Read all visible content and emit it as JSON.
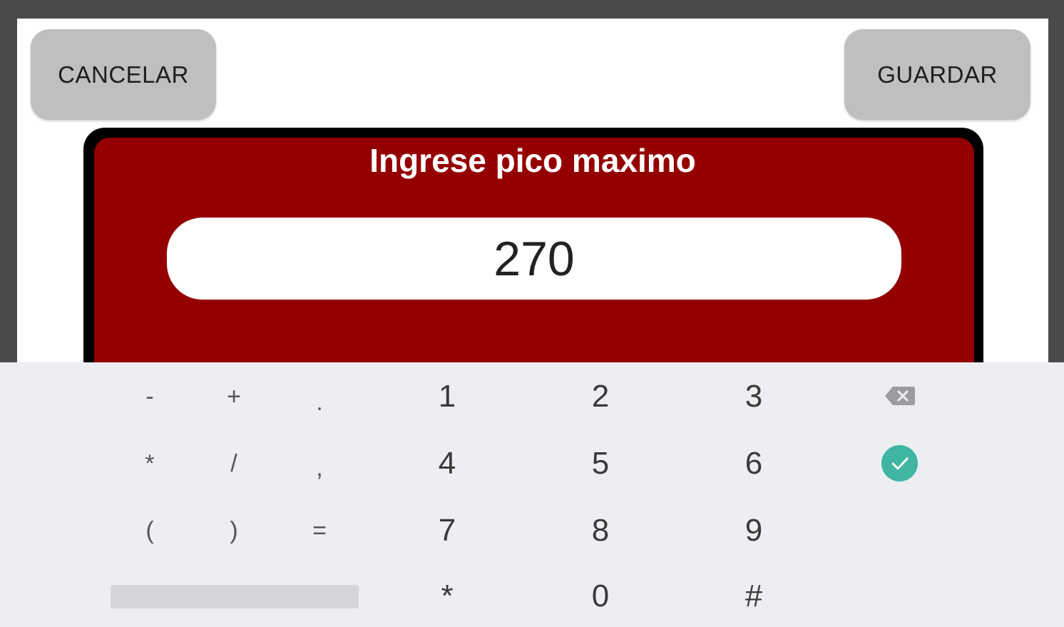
{
  "toolbar": {
    "cancel_label": "CANCELAR",
    "save_label": "GUARDAR"
  },
  "dialog": {
    "title": "Ingrese pico maximo",
    "value": "270"
  },
  "keyboard": {
    "row1": [
      "-",
      "+",
      ".",
      "1",
      "2",
      "3"
    ],
    "row2": [
      "*",
      "/",
      ",",
      "4",
      "5",
      "6"
    ],
    "row3": [
      "(",
      ")",
      "=",
      "7",
      "8",
      "9"
    ],
    "row4": [
      "*",
      "0",
      "#"
    ],
    "backspace_icon": "backspace-icon",
    "enter_icon": "check-icon"
  },
  "colors": {
    "dialog_background": "#940000",
    "button_gray": "#bfbfbf",
    "enter_key": "#3fb5a2"
  }
}
